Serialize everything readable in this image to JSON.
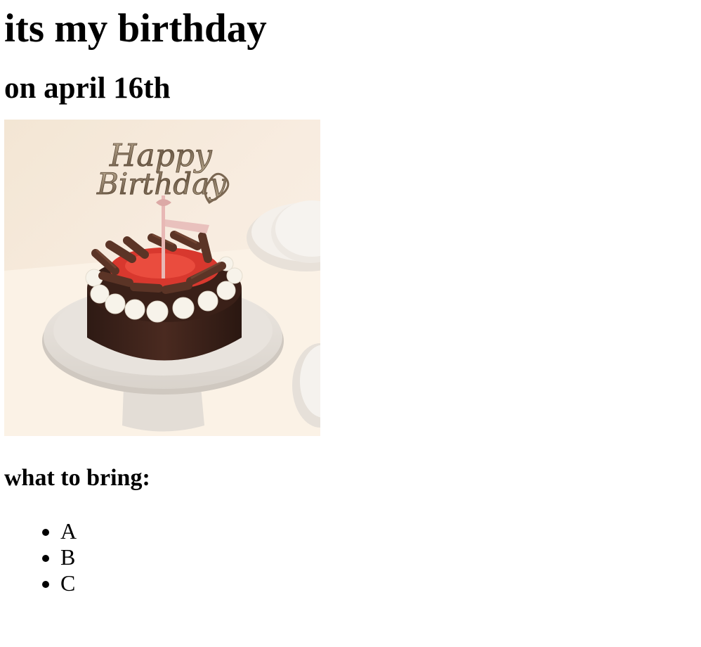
{
  "title": "its my birthday",
  "subtitle": "on april 16th",
  "image": {
    "topper_text_line1": "Happy",
    "topper_text_line2": "Birthday"
  },
  "bring_heading": "what to bring:",
  "bring_items": [
    "A",
    "B",
    "C"
  ]
}
